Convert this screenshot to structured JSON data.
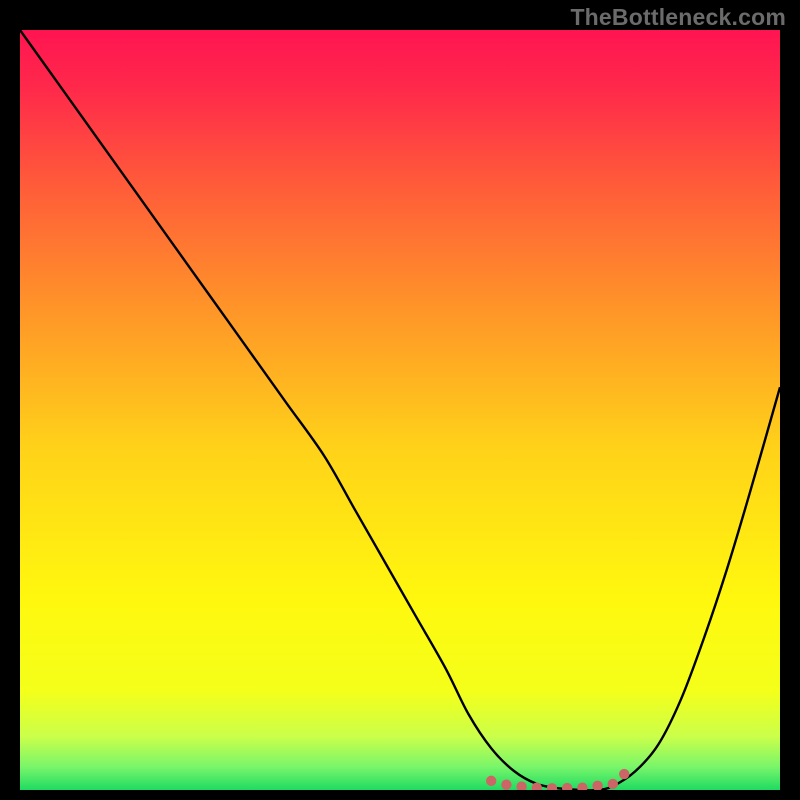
{
  "watermark": "TheBottleneck.com",
  "chart_data": {
    "type": "line",
    "title": "",
    "xlabel": "",
    "ylabel": "",
    "xlim": [
      0,
      100
    ],
    "ylim": [
      0,
      100
    ],
    "grid": false,
    "legend": false,
    "background": {
      "type": "vertical-gradient",
      "stops": [
        {
          "pos": 0.0,
          "color": "#ff1452"
        },
        {
          "pos": 0.08,
          "color": "#ff2a4a"
        },
        {
          "pos": 0.2,
          "color": "#ff5a3a"
        },
        {
          "pos": 0.35,
          "color": "#ff8f2a"
        },
        {
          "pos": 0.55,
          "color": "#ffd219"
        },
        {
          "pos": 0.75,
          "color": "#fff80e"
        },
        {
          "pos": 0.87,
          "color": "#f4ff1a"
        },
        {
          "pos": 0.93,
          "color": "#caff4a"
        },
        {
          "pos": 0.97,
          "color": "#78f56a"
        },
        {
          "pos": 1.0,
          "color": "#1edb62"
        }
      ]
    },
    "series": [
      {
        "name": "bottleneck-curve",
        "color": "#000000",
        "x": [
          0,
          5,
          10,
          15,
          20,
          25,
          30,
          35,
          40,
          44,
          48,
          52,
          56,
          59,
          62,
          65,
          68,
          71,
          74,
          76,
          78,
          81,
          84,
          87,
          90,
          93,
          96,
          100
        ],
        "y": [
          100,
          93,
          86,
          79,
          72,
          65,
          58,
          51,
          44,
          37,
          30,
          23,
          16,
          10,
          5.5,
          2.5,
          0.8,
          0.2,
          0,
          0,
          0.5,
          2.5,
          6,
          12,
          20,
          29,
          39,
          53
        ]
      }
    ],
    "markers": [
      {
        "name": "valley-marker",
        "color": "#cc6666",
        "x": 62,
        "y": 1.2
      },
      {
        "name": "valley-marker",
        "color": "#cc6666",
        "x": 64,
        "y": 0.7
      },
      {
        "name": "valley-marker",
        "color": "#cc6666",
        "x": 66,
        "y": 0.45
      },
      {
        "name": "valley-marker",
        "color": "#cc6666",
        "x": 68,
        "y": 0.3
      },
      {
        "name": "valley-marker",
        "color": "#cc6666",
        "x": 70,
        "y": 0.22
      },
      {
        "name": "valley-marker",
        "color": "#cc6666",
        "x": 72,
        "y": 0.25
      },
      {
        "name": "valley-marker",
        "color": "#cc6666",
        "x": 74,
        "y": 0.3
      },
      {
        "name": "valley-marker",
        "color": "#cc6666",
        "x": 76,
        "y": 0.55
      },
      {
        "name": "valley-marker",
        "color": "#cc6666",
        "x": 78,
        "y": 0.8
      },
      {
        "name": "valley-marker",
        "color": "#cc6666",
        "x": 79.5,
        "y": 2.1
      }
    ]
  }
}
